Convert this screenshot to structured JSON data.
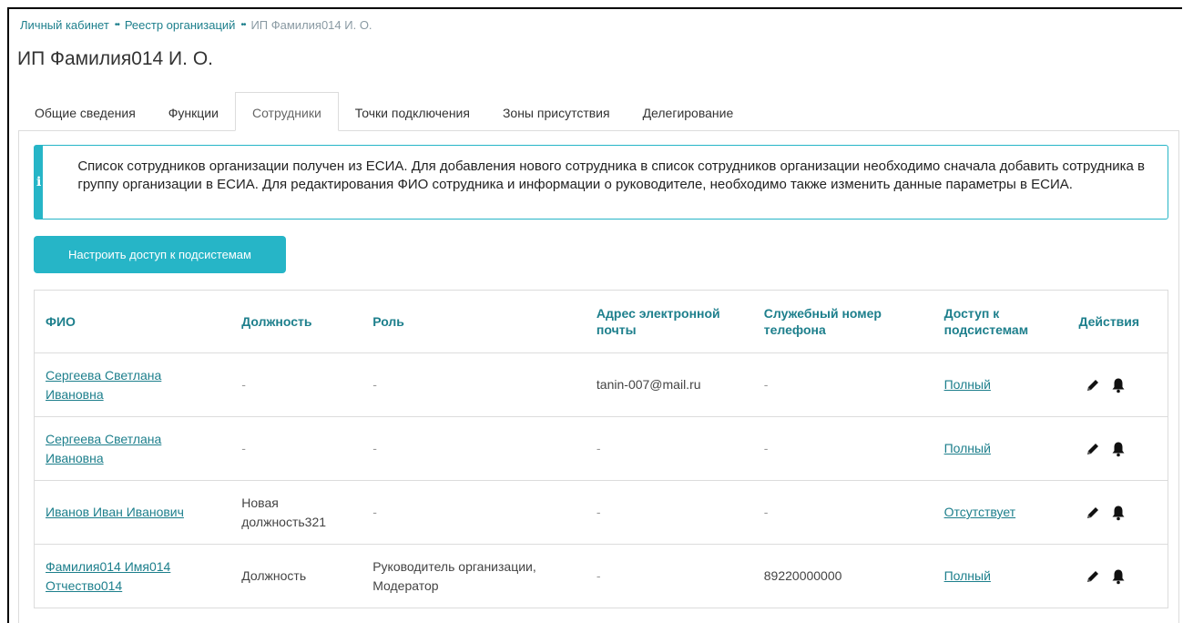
{
  "breadcrumb": {
    "items": [
      "Личный кабинет",
      "Реестр организаций",
      "ИП Фамилия014 И. О."
    ],
    "separator": "••"
  },
  "page_title": "ИП Фамилия014 И. О.",
  "tabs": [
    {
      "label": "Общие сведения",
      "active": false
    },
    {
      "label": "Функции",
      "active": false
    },
    {
      "label": "Сотрудники",
      "active": true
    },
    {
      "label": "Точки подключения",
      "active": false
    },
    {
      "label": "Зоны присутствия",
      "active": false
    },
    {
      "label": "Делегирование",
      "active": false
    }
  ],
  "info": {
    "icon": "info-icon",
    "icon_glyph": "i",
    "text": "Список сотрудников организации получен из ЕСИА. Для добавления нового сотрудника в список сотрудников организации необходимо сначала добавить сотрудника в группу организации в ЕСИА. Для редактирования ФИО сотрудника и информации о руководителе, необходимо также изменить данные параметры в ЕСИА."
  },
  "configure_button_label": "Настроить доступ к подсистемам",
  "table": {
    "headers": [
      "ФИО",
      "Должность",
      "Роль",
      "Адрес электронной почты",
      "Служебный номер телефона",
      "Доступ к подсистемам",
      "Действия"
    ],
    "rows": [
      {
        "name": "Сергеева Светлана Ивановна",
        "position": "-",
        "role": "-",
        "email": "tanin-007@mail.ru",
        "phone": "-",
        "access": "Полный"
      },
      {
        "name": "Сергеева Светлана Ивановна",
        "position": "-",
        "role": "-",
        "email": "-",
        "phone": "-",
        "access": "Полный"
      },
      {
        "name": "Иванов Иван Иванович",
        "position": "Новая должность321",
        "role": "-",
        "email": "-",
        "phone": "-",
        "access": "Отсутствует"
      },
      {
        "name": "Фамилия014 Имя014 Отчество014",
        "position": "Должность",
        "role": "Руководитель организации, Модератор",
        "email": "-",
        "phone": "89220000000",
        "access": "Полный"
      }
    ],
    "row_actions": [
      "pencil-icon",
      "bell-icon"
    ]
  },
  "colors": {
    "accent": "#26b5c7",
    "link": "#1d7f8c",
    "border": "#dcdcdc"
  }
}
